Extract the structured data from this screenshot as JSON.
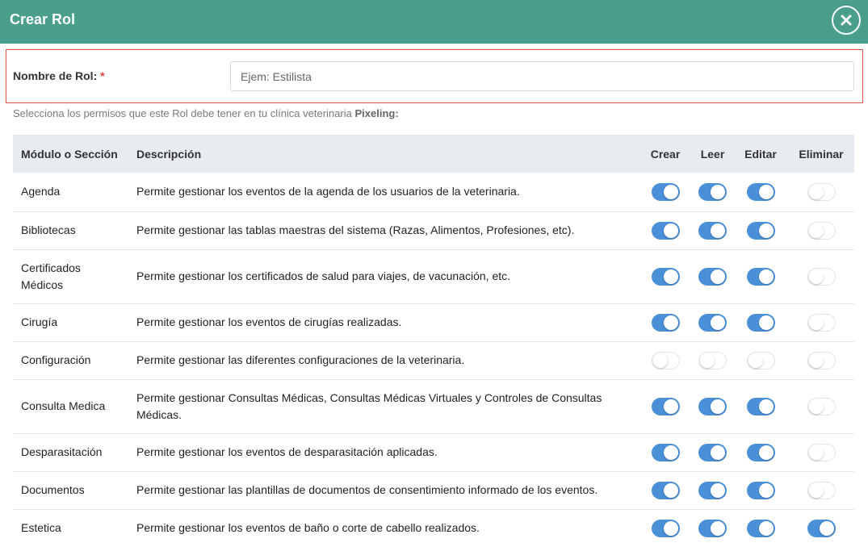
{
  "dialog": {
    "title": "Crear Rol",
    "close_icon": "close-circle-icon"
  },
  "role_name": {
    "label": "Nombre de Rol:",
    "required_mark": "*",
    "placeholder": "Ejem: Estilista",
    "value": ""
  },
  "instructions": {
    "text": "Selecciona los permisos que este Rol debe tener en tu clínica veterinaria",
    "clinic": "Pixeling:"
  },
  "table": {
    "headers": {
      "module": "Módulo o Sección",
      "description": "Descripción",
      "create": "Crear",
      "read": "Leer",
      "edit": "Editar",
      "delete": "Eliminar"
    },
    "rows": [
      {
        "module": "Agenda",
        "description": "Permite gestionar los eventos de la agenda de los usuarios de la veterinaria.",
        "crear": true,
        "leer": true,
        "editar": true,
        "eliminar": false
      },
      {
        "module": "Bibliotecas",
        "description": "Permite gestionar las tablas maestras del sistema (Razas, Alimentos, Profesiones, etc).",
        "crear": true,
        "leer": true,
        "editar": true,
        "eliminar": false
      },
      {
        "module": "Certificados Médicos",
        "description": "Permite gestionar los certificados de salud para viajes, de vacunación, etc.",
        "crear": true,
        "leer": true,
        "editar": true,
        "eliminar": false
      },
      {
        "module": "Cirugía",
        "description": "Permite gestionar los eventos de cirugías realizadas.",
        "crear": true,
        "leer": true,
        "editar": true,
        "eliminar": false
      },
      {
        "module": "Configuración",
        "description": "Permite gestionar las diferentes configuraciones de la veterinaria.",
        "crear": false,
        "leer": false,
        "editar": false,
        "eliminar": false
      },
      {
        "module": "Consulta Medica",
        "description": "Permite gestionar Consultas Médicas, Consultas Médicas Virtuales y Controles de Consultas Médicas.",
        "crear": true,
        "leer": true,
        "editar": true,
        "eliminar": false
      },
      {
        "module": "Desparasitación",
        "description": "Permite gestionar los eventos de desparasitación aplicadas.",
        "crear": true,
        "leer": true,
        "editar": true,
        "eliminar": false
      },
      {
        "module": "Documentos",
        "description": "Permite gestionar las plantillas de documentos de consentimiento informado de los eventos.",
        "crear": true,
        "leer": true,
        "editar": true,
        "eliminar": false
      },
      {
        "module": "Estetica",
        "description": "Permite gestionar los eventos de baño o corte de cabello realizados.",
        "crear": true,
        "leer": true,
        "editar": true,
        "eliminar": true
      }
    ]
  },
  "colors": {
    "header_bg": "#4a9f8c",
    "toggle_on": "#4a90d9",
    "required_border": "#d9534f"
  }
}
